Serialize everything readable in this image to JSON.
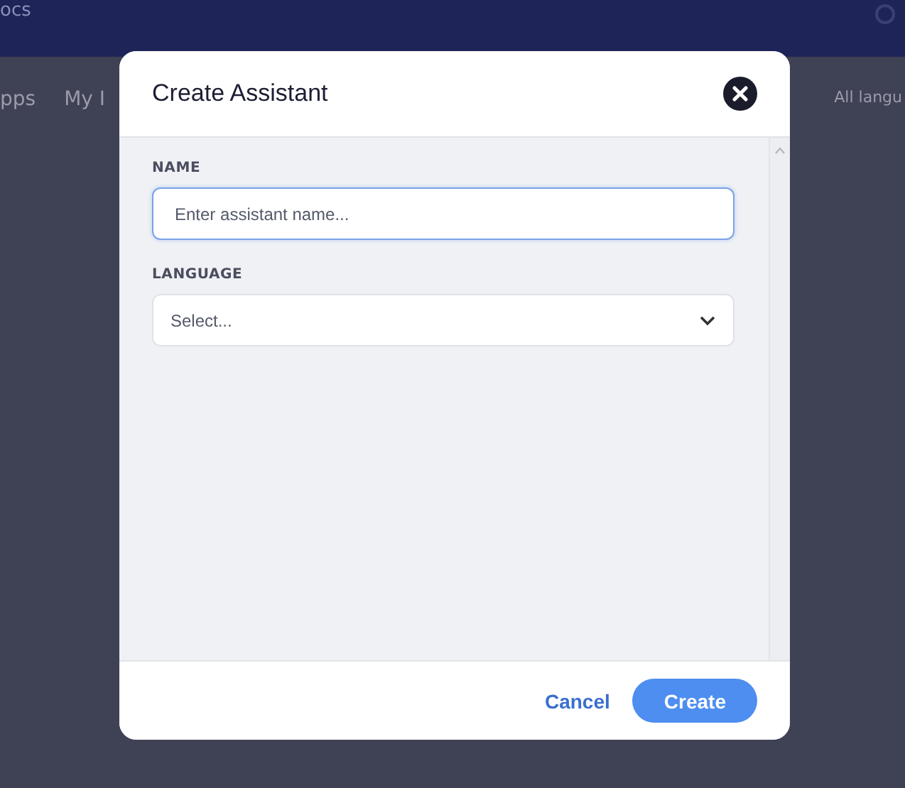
{
  "background": {
    "top_bar": {
      "title": "ocs"
    },
    "nav": [
      {
        "label": "pps"
      },
      {
        "label": "My I"
      }
    ],
    "filter": "All langu"
  },
  "dialog": {
    "title": "Create Assistant",
    "fields": [
      {
        "kind": "text",
        "label": "NAME",
        "placeholder": "Enter assistant name...",
        "focused": true
      },
      {
        "kind": "select",
        "label": "LANGUAGE",
        "placeholder": "Select...",
        "focused": false
      }
    ],
    "buttons": [
      {
        "kind": "link",
        "label": "Cancel"
      },
      {
        "kind": "primary",
        "label": "Create"
      }
    ]
  }
}
